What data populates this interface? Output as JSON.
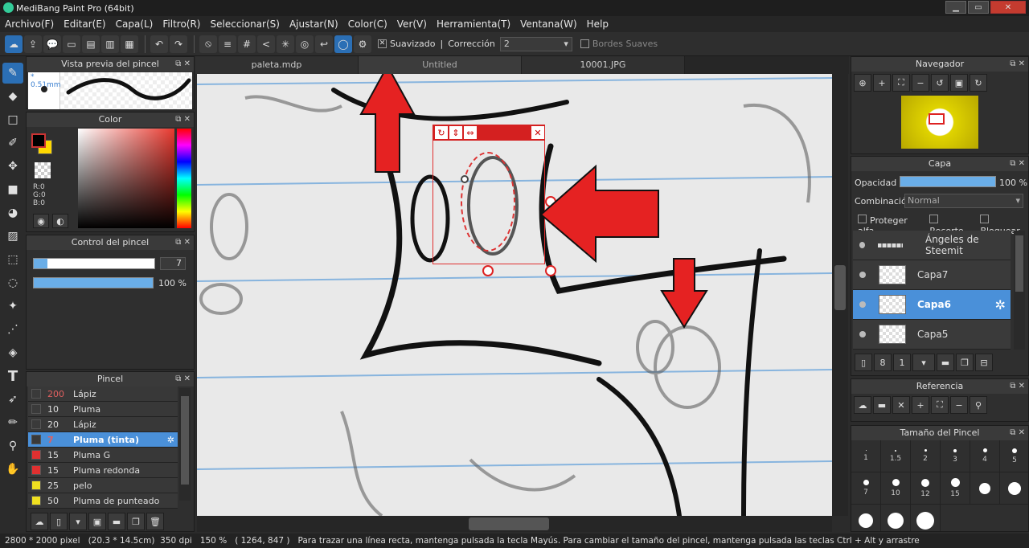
{
  "window": {
    "title": "MediBang Paint Pro (64bit)",
    "min": "▁",
    "max": "▭",
    "close": "✕"
  },
  "menu": [
    "Archivo(F)",
    "Editar(E)",
    "Capa(L)",
    "Filtro(R)",
    "Seleccionar(S)",
    "Ajustar(N)",
    "Color(C)",
    "Ver(V)",
    "Herramienta(T)",
    "Ventana(W)",
    "Help"
  ],
  "toolbar": {
    "suavizado": "Suavizado",
    "correccion": "Corrección",
    "correccion_value": "2",
    "bordes": "Bordes Suaves"
  },
  "tabs": [
    "paleta.mdp",
    "Untitled",
    "10001.JPG"
  ],
  "brush_preview": {
    "title": "Vista previa del pincel",
    "size": "0.51mm"
  },
  "color": {
    "title": "Color",
    "r": "R:0",
    "g": "G:0",
    "b": "B:0"
  },
  "brush_control": {
    "title": "Control del pincel",
    "size": "7",
    "opacity": "100 %",
    "size_fill": 0.11,
    "opacity_fill": 1
  },
  "brushes": {
    "title": "Pincel",
    "items": [
      {
        "size": "200",
        "name": "Lápiz",
        "color": "#3a3a3a"
      },
      {
        "size": "10",
        "name": "Pluma",
        "color": "#3a3a3a"
      },
      {
        "size": "20",
        "name": "Lápiz",
        "color": "#3a3a3a"
      },
      {
        "size": "7",
        "name": "Pluma (tinta)",
        "color": "#3a3a3a"
      },
      {
        "size": "15",
        "name": "Pluma G",
        "color": "#e03030"
      },
      {
        "size": "15",
        "name": "Pluma redonda",
        "color": "#e03030"
      },
      {
        "size": "25",
        "name": "pelo",
        "color": "#f0e020"
      },
      {
        "size": "50",
        "name": "Pluma de punteado",
        "color": "#f0e020"
      }
    ]
  },
  "navigator": {
    "title": "Navegador"
  },
  "layers": {
    "title": "Capa",
    "opacity_label": "Opacidad",
    "opacity": "100 %",
    "blend_label": "Combinación",
    "blend": "Normal",
    "protect": "Proteger alfa",
    "clip": "Recorte",
    "lock": "Bloquear",
    "items": [
      "Ángeles de Steemit",
      "Capa7",
      "Capa6",
      "Capa5"
    ]
  },
  "reference": {
    "title": "Referencia"
  },
  "brush_size": {
    "title": "Tamaño del Pincel",
    "sizes": [
      "1",
      "1.5",
      "2",
      "3",
      "4",
      "5",
      "7",
      "10",
      "12",
      "15"
    ]
  },
  "status": {
    "dims": "2800 * 2000 pixel",
    "cm": "(20.3 * 14.5cm)",
    "dpi": "350 dpi",
    "zoom": "150 %",
    "coords": "( 1264, 847 )",
    "hint": "Para trazar una línea recta, mantenga pulsada la tecla Mayús. Para cambiar el tamaño del pincel, mantenga pulsada las teclas Ctrl + Alt y arrastre"
  }
}
